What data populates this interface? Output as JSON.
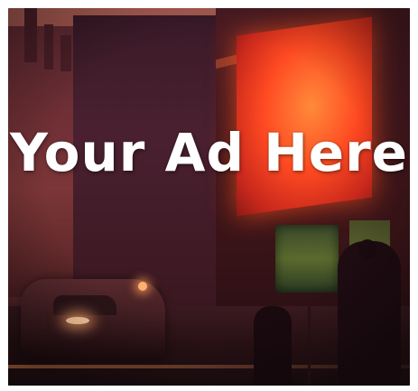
{
  "ad": {
    "headline": "Your Ad Here"
  },
  "scene": {
    "description_icon": "city-street-night-image"
  },
  "colors": {
    "headline_text": "#ffffff",
    "neon_glow": "#ff4a22"
  }
}
